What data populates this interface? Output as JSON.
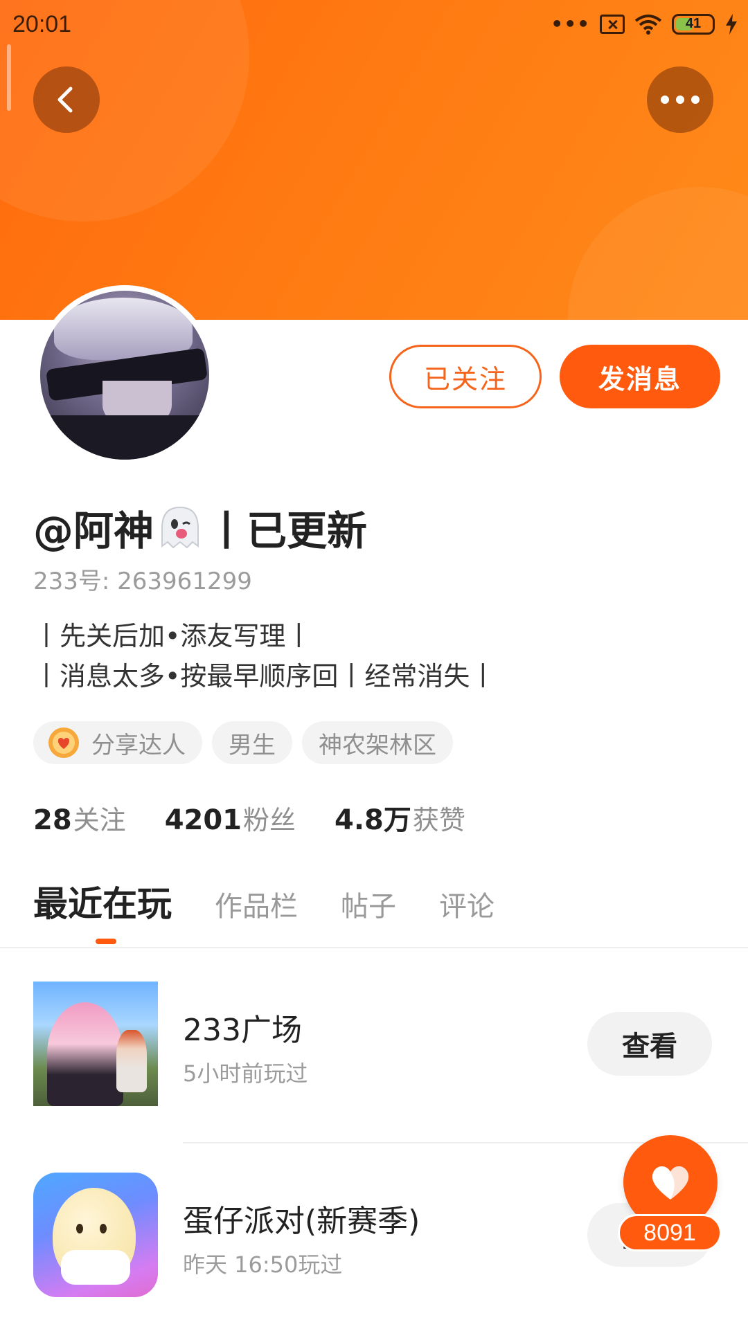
{
  "status_bar": {
    "time": "20:01",
    "dots": "•••",
    "battery_level": "41",
    "icons": [
      "sim-icon",
      "wifi-icon",
      "battery-icon",
      "charging-bolt-icon"
    ]
  },
  "header": {
    "back_icon": "chevron-left-icon",
    "more_icon": "more-dots-icon"
  },
  "profile": {
    "name_prefix": "@阿神",
    "name_suffix": "丨已更新",
    "uid": "233号: 263961299",
    "bio_line1": "丨先关后加•添友写理丨",
    "bio_line2": "丨消息太多•按最早顺序回丨经常消失丨"
  },
  "actions": {
    "follow_label": "已关注",
    "message_label": "发消息"
  },
  "tags": {
    "items": [
      "分享达人",
      "男生",
      "神农架林区"
    ]
  },
  "stats": {
    "following_count": "28",
    "following_label": "关注",
    "fans_count": "4201",
    "fans_label": "粉丝",
    "likes_count": "4.8万",
    "likes_label": "获赞"
  },
  "tabs": {
    "items": [
      "最近在玩",
      "作品栏",
      "帖子",
      "评论"
    ],
    "active": "最近在玩"
  },
  "games": [
    {
      "title": "233广场",
      "subtitle": "5小时前玩过",
      "button": "查看"
    },
    {
      "title": "蛋仔派对(新赛季)",
      "subtitle": "昨天 16:50玩过",
      "button": "查看"
    }
  ],
  "like_fab": {
    "count": "8091"
  },
  "colors": {
    "brand_orange": "#ff5a0e",
    "banner_orange": "#ff7a12",
    "muted_text": "#9b9b9b"
  }
}
